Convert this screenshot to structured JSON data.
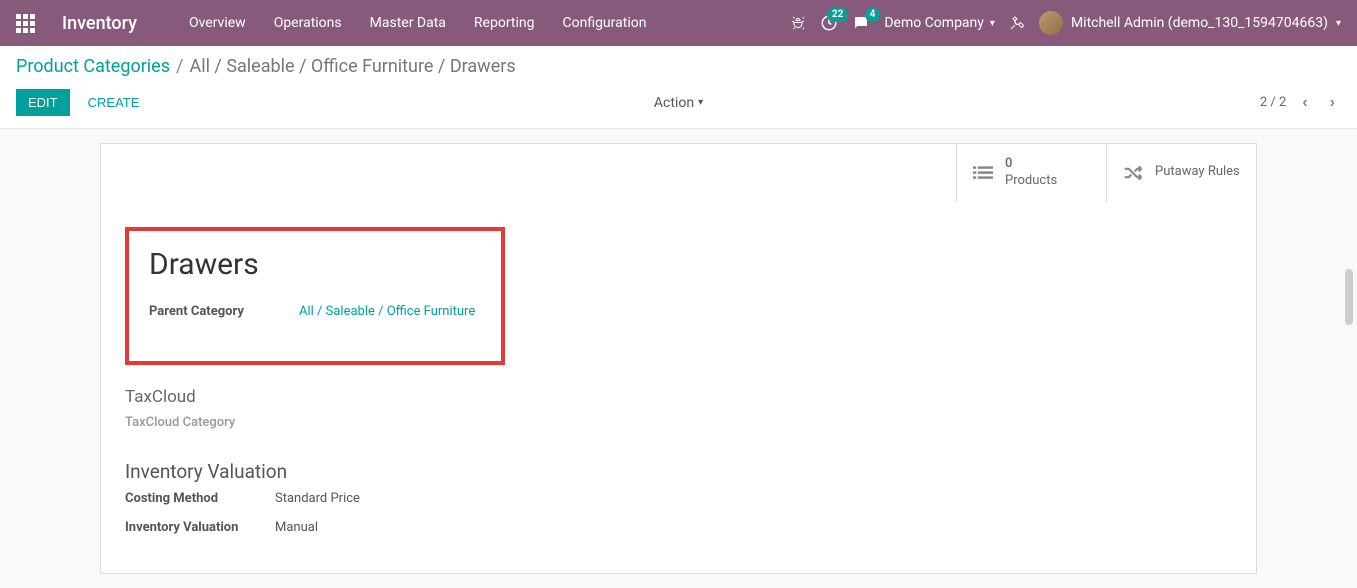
{
  "topbar": {
    "brand": "Inventory",
    "nav": [
      "Overview",
      "Operations",
      "Master Data",
      "Reporting",
      "Configuration"
    ],
    "clock_badge": "22",
    "chat_badge": "4",
    "company": "Demo Company",
    "user": "Mitchell Admin (demo_130_1594704663)"
  },
  "breadcrumb": {
    "root": "Product Categories",
    "path": "All / Saleable / Office Furniture / Drawers"
  },
  "controls": {
    "edit": "EDIT",
    "create": "CREATE",
    "action": "Action",
    "pager": "2 / 2"
  },
  "stat_buttons": {
    "products_count": "0",
    "products_label": "Products",
    "putaway_label": "Putaway Rules"
  },
  "record": {
    "title": "Drawers",
    "parent_label": "Parent Category",
    "parent_value": "All / Saleable / Office Furniture",
    "taxcloud_title": "TaxCloud",
    "taxcloud_cat_label": "TaxCloud Category",
    "valuation_title": "Inventory Valuation",
    "costing_label": "Costing Method",
    "costing_value": "Standard Price",
    "inv_val_label": "Inventory Valuation",
    "inv_val_value": "Manual"
  }
}
